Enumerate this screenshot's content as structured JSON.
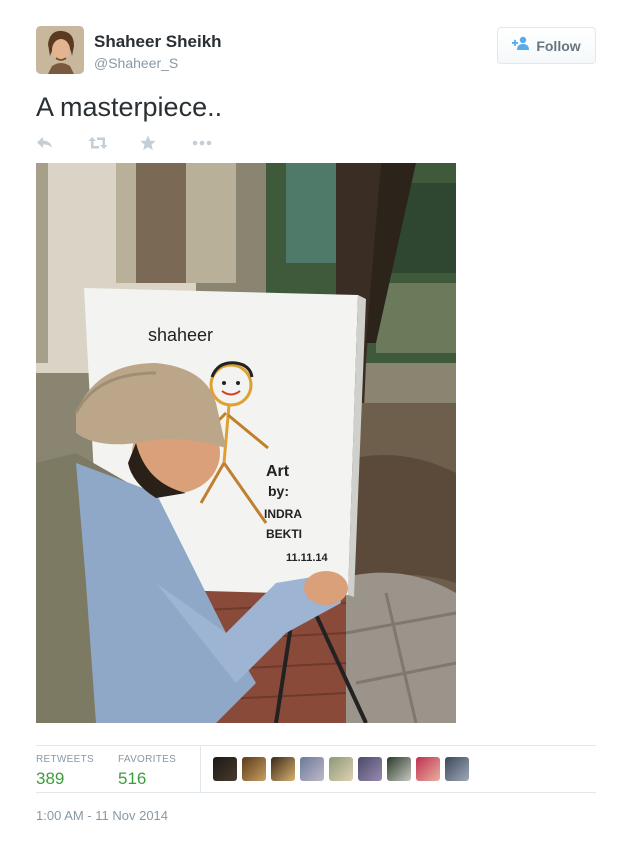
{
  "user": {
    "full_name": "Shaheer Sheikh",
    "screen_name": "@Shaheer_S"
  },
  "follow_button": {
    "label": "Follow"
  },
  "tweet": {
    "text": "A masterpiece.."
  },
  "actions": [
    "reply-icon",
    "retweet-icon",
    "favorite-icon",
    "more-icon"
  ],
  "photo": {
    "board_text": {
      "name": "shaheer",
      "art_line1": "Art",
      "art_line2": "by:",
      "artist_line1": "INDRA",
      "artist_line2": "BEKTI",
      "date": "11.11.14"
    }
  },
  "stats": {
    "retweets_label": "RETWEETS",
    "retweets_value": "389",
    "favorites_label": "FAVORITES",
    "favorites_value": "516"
  },
  "favoriters_count": 9,
  "timestamp": "1:00 AM - 11 Nov 2014",
  "colors": {
    "text": "#292f33",
    "muted": "#8899a6",
    "count_green": "#3b9e3b",
    "divider": "#e1e8ed",
    "follow_icon": "#55acee"
  }
}
